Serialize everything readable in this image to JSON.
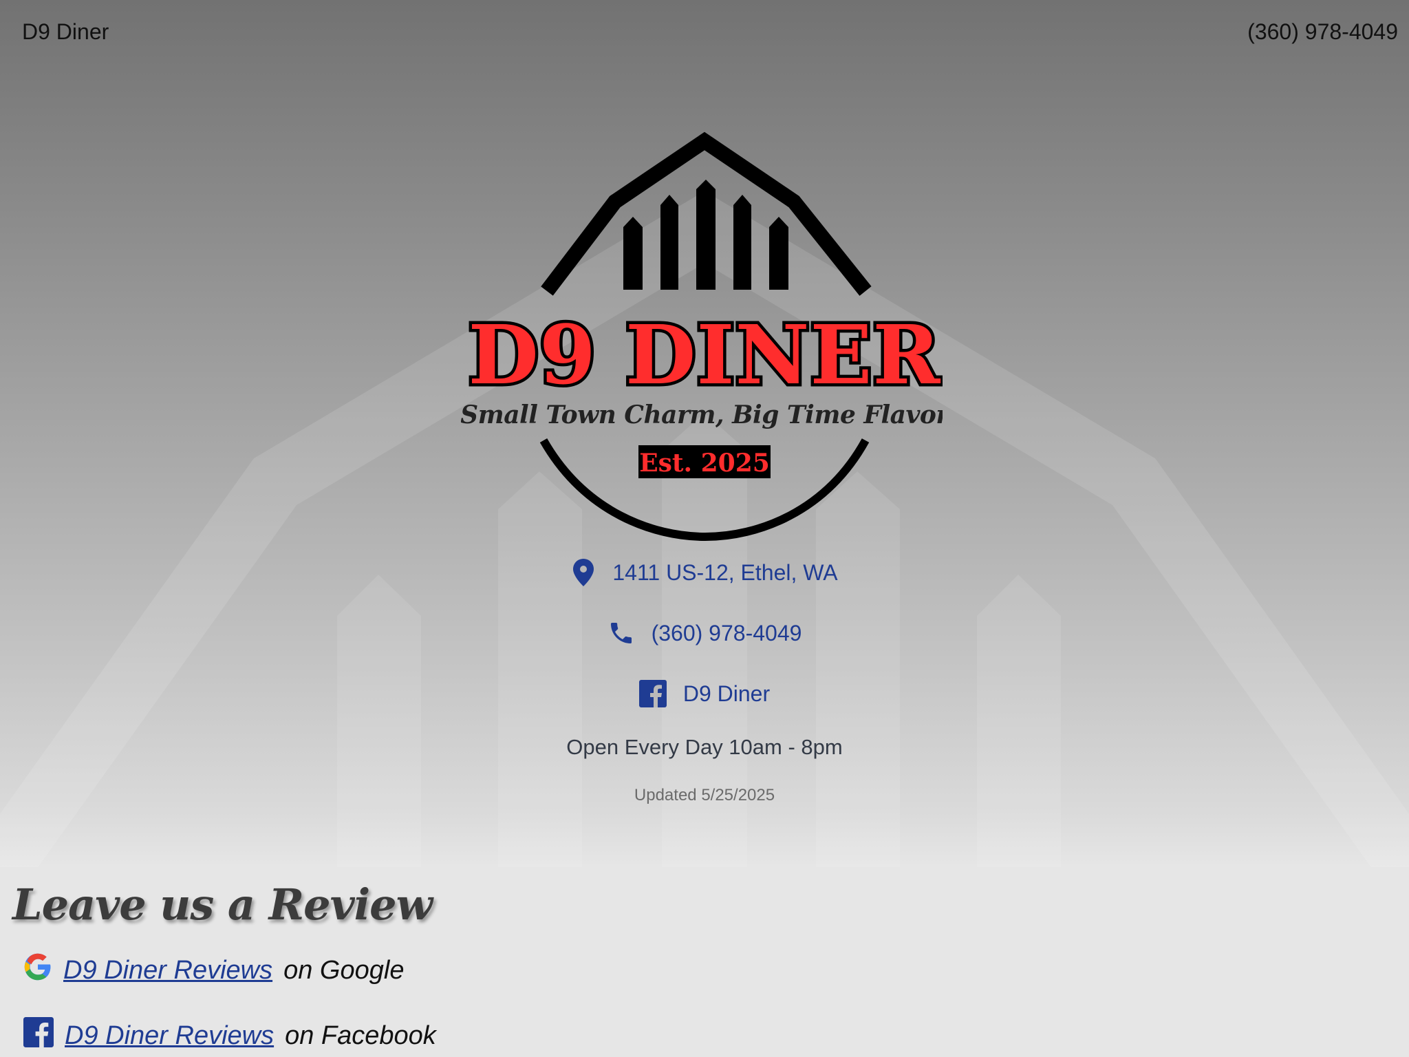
{
  "header": {
    "brand": "D9 Diner",
    "phone": "(360) 978-4049"
  },
  "logo": {
    "name": "D9 DINER",
    "tagline": "Small Town Charm, Big Time Flavor",
    "established": "Est. 2025",
    "accent_color": "#ff2d2d"
  },
  "contact": {
    "address": "1411 US-12, Ethel, WA",
    "phone": "(360) 978-4049",
    "facebook": "D9 Diner",
    "link_color": "#1f3c93"
  },
  "hours": "Open Every Day 10am - 8pm",
  "updated": "Updated 5/25/2025",
  "reviews": {
    "title": "Leave us a Review",
    "items": [
      {
        "link": "D9 Diner Reviews",
        "suffix": "on Google",
        "icon": "google-icon"
      },
      {
        "link": "D9 Diner Reviews",
        "suffix": "on Facebook",
        "icon": "facebook-icon"
      }
    ]
  }
}
